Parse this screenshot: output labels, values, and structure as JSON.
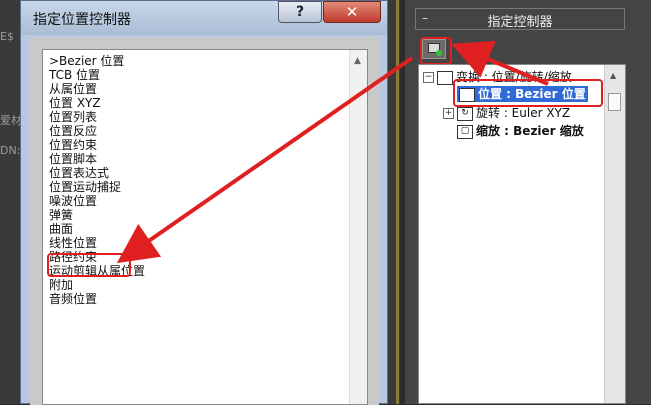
{
  "background": {
    "hints": [
      "爱材",
      "DN:",
      "E$"
    ]
  },
  "dialog": {
    "title": "指定位置控制器",
    "help_label": "?",
    "close_label": "✕",
    "controllers": [
      ">Bezier 位置",
      "TCB 位置",
      "从属位置",
      "位置 XYZ",
      "位置列表",
      "位置反应",
      "位置约束",
      "位置脚本",
      "位置表达式",
      "位置运动捕捉",
      "噪波位置",
      "弹簧",
      "曲面",
      "线性位置",
      "路径约束",
      "运动剪辑从属位置",
      "附加",
      "音频位置"
    ],
    "highlighted_item": "路径约束"
  },
  "panel": {
    "rollout_toggle": "–",
    "rollout_title": "指定控制器",
    "tree": {
      "root": "变换 : 位置/旋转/缩放",
      "position": "位置 : Bezier 位置",
      "rotation": "旋转 : Euler XYZ",
      "scale": "缩放 : Bezier 缩放"
    }
  },
  "colors": {
    "annotation_red": "#e02020",
    "selection_blue": "#2f6ad6"
  }
}
